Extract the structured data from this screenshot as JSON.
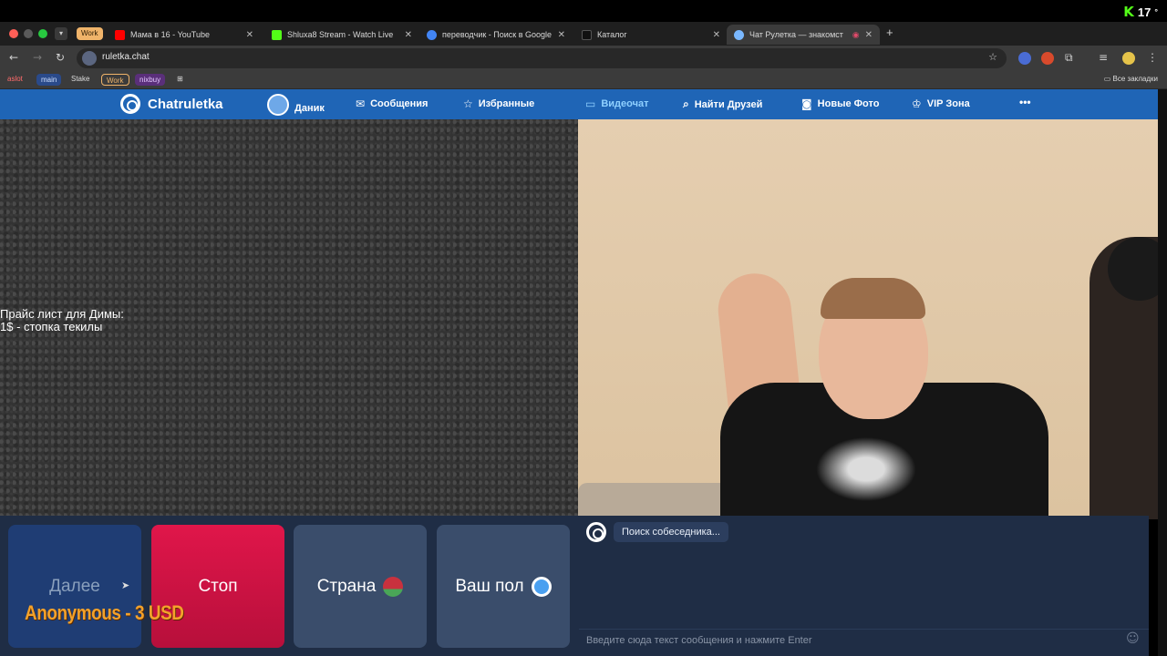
{
  "os": {
    "stream_logo": "K",
    "viewer_count": "17"
  },
  "tabs": {
    "group_label": "Work",
    "items": [
      {
        "title": "Мама в 16 - YouTube",
        "favicon_color": "#ff0000"
      },
      {
        "title": "Shluxa8 Stream - Watch Live",
        "favicon_color": "#53fc18"
      },
      {
        "title": "переводчик - Поиск в Google",
        "favicon_color": "#4285f4"
      },
      {
        "title": "Каталог",
        "favicon_color": "#111111"
      },
      {
        "title": "Чат Рулетка — знакомст",
        "favicon_color": "#7ab8ff"
      }
    ],
    "new_tab": "+"
  },
  "toolbar": {
    "url": "ruletka.chat"
  },
  "bookmarks": {
    "items": [
      "aslot",
      "main",
      "Stake",
      "Work",
      "nixbuy"
    ],
    "all_label": "Все закладки"
  },
  "site_nav": {
    "logo": "Chatruletka",
    "items": [
      {
        "label": "Даник",
        "icon": "avatar-icon"
      },
      {
        "label": "Сообщения",
        "icon": "mail-icon"
      },
      {
        "label": "Избранные",
        "icon": "star-icon"
      },
      {
        "label": "Видеочат",
        "icon": "video-icon"
      },
      {
        "label": "Найти Друзей",
        "icon": "search-icon"
      },
      {
        "label": "Новые Фото",
        "icon": "camera-icon"
      },
      {
        "label": "VIP Зона",
        "icon": "crown-icon"
      }
    ],
    "more": "•••",
    "active_color": "#8fd0ff"
  },
  "overlay": {
    "line1": "Прайс лист для Димы:",
    "line2": "1$ - стопка текилы"
  },
  "controls": {
    "next": "Далее",
    "stop": "Стоп",
    "country": "Страна",
    "gender": "Ваш пол"
  },
  "donation": {
    "text": "Anonymous - 3 USD"
  },
  "chat": {
    "status": "Поиск собеседника...",
    "input_placeholder": "Введите сюда текст сообщения и нажмите Enter"
  }
}
